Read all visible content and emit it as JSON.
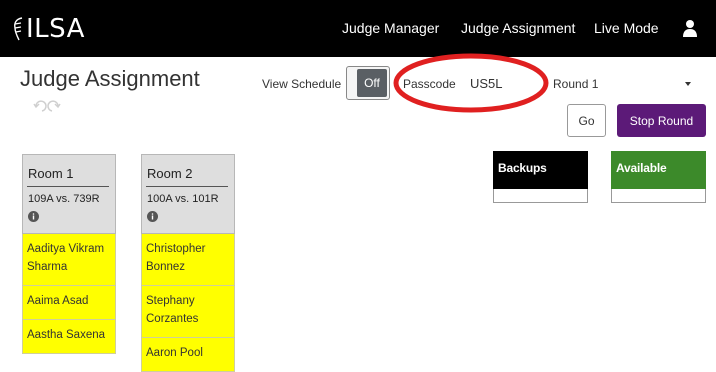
{
  "nav": {
    "brand": "ILSA",
    "links": [
      "Judge Manager",
      "Judge Assignment",
      "Live Mode"
    ],
    "icons": {
      "brand": "leaf-logo-icon",
      "user": "user-icon"
    }
  },
  "header": {
    "title": "Judge Assignment",
    "view_schedule_label": "View Schedule",
    "toggle_state": "Off",
    "passcode_label": "Passcode",
    "passcode_value": "US5L",
    "round_selected": "Round 1",
    "go_label": "Go",
    "stop_label": "Stop Round"
  },
  "rooms": [
    {
      "name": "Room 1",
      "match": "109A vs. 739R",
      "judges": [
        "Aaditya Vikram Sharma",
        "Aaima Asad",
        "Aastha Saxena"
      ]
    },
    {
      "name": "Room 2",
      "match": "100A vs. 101R",
      "judges": [
        "Christopher Bonnez",
        "Stephany Corzantes",
        "Aaron Pool"
      ]
    }
  ],
  "pools": {
    "backups": "Backups",
    "available": "Available"
  },
  "colors": {
    "navbar": "#000000",
    "stop_button": "#5c1a78",
    "judge_card": "#ffff00",
    "backups_header": "#000000",
    "available_header": "#3c8a2a",
    "highlight_ring": "#e02020"
  }
}
